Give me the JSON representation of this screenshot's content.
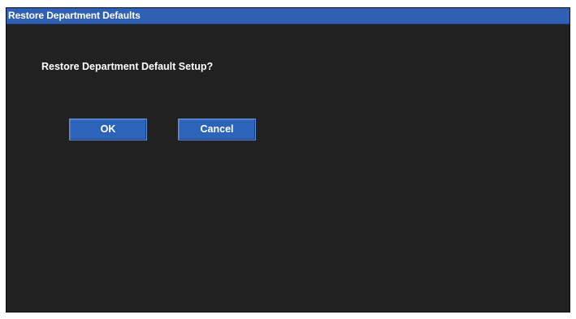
{
  "dialog": {
    "title": "Restore Department Defaults",
    "prompt": "Restore Department Default Setup?",
    "buttons": {
      "ok_label": "OK",
      "cancel_label": "Cancel"
    }
  },
  "colors": {
    "background": "#212121",
    "titlebar": "#2f60b4",
    "button": "#2c64bc",
    "text": "#ffffff"
  }
}
